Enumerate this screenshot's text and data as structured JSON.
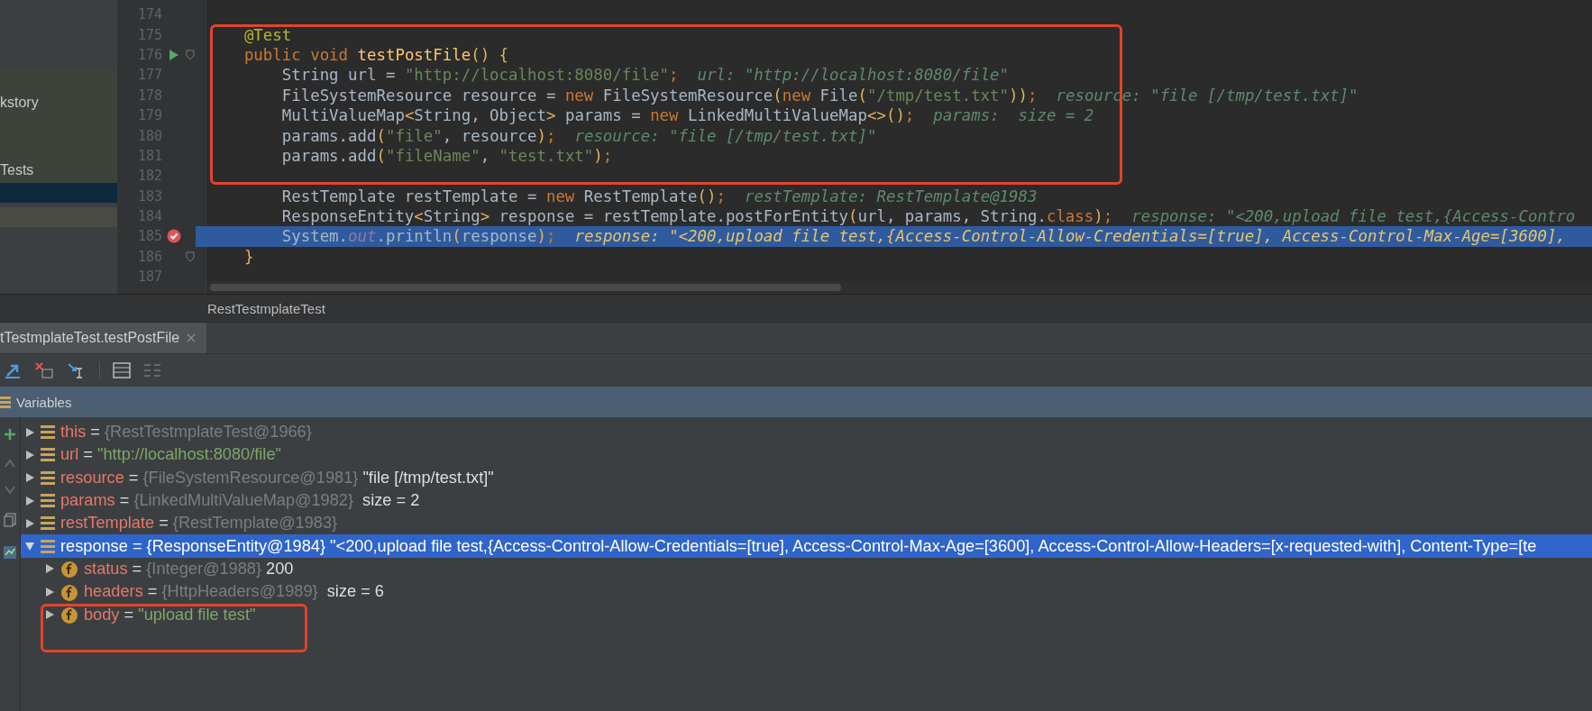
{
  "project_sidebar": {
    "items": [
      {
        "label": "kstory",
        "selected": false
      },
      {
        "label": "Tests",
        "selected": false
      }
    ]
  },
  "editor": {
    "lines": [
      {
        "number": "174",
        "runnable": false,
        "breakpoint": false,
        "foldable": false,
        "selected": false
      },
      {
        "number": "175",
        "runnable": false,
        "breakpoint": false,
        "foldable": false,
        "selected": false,
        "tokens": [
          {
            "t": "    @Test",
            "kind": "ann"
          }
        ]
      },
      {
        "number": "176",
        "runnable": true,
        "breakpoint": false,
        "foldable": true,
        "selected": false,
        "tokens": [
          {
            "t": "    public void ",
            "kind": "kw"
          },
          {
            "t": "testPostFile",
            "kind": "meth"
          },
          {
            "t": "() {",
            "kind": "punct"
          }
        ]
      },
      {
        "number": "177",
        "runnable": false,
        "breakpoint": false,
        "foldable": false,
        "selected": false,
        "tokens": [
          {
            "t": "        String url = ",
            "kind": "plain"
          },
          {
            "t": "\"http://localhost:8080/file\"",
            "kind": "str"
          },
          {
            "t": ";",
            "kind": "kw"
          }
        ],
        "hint": "url: \"http://localhost:8080/file\""
      },
      {
        "number": "178",
        "runnable": false,
        "breakpoint": false,
        "foldable": false,
        "selected": false,
        "tokens": [
          {
            "t": "        FileSystemResource resource = ",
            "kind": "plain"
          },
          {
            "t": "new",
            "kind": "kw"
          },
          {
            "t": " FileSystemResource",
            "kind": "plain"
          },
          {
            "t": "(",
            "kind": "punct"
          },
          {
            "t": "new",
            "kind": "kw"
          },
          {
            "t": " File",
            "kind": "plain"
          },
          {
            "t": "(",
            "kind": "punct"
          },
          {
            "t": "\"/tmp/test.txt\"",
            "kind": "str"
          },
          {
            "t": "))",
            "kind": "punct"
          },
          {
            "t": ";",
            "kind": "kw"
          }
        ],
        "hint": "resource: \"file [/tmp/test.txt]\""
      },
      {
        "number": "179",
        "runnable": false,
        "breakpoint": false,
        "foldable": false,
        "selected": false,
        "tokens": [
          {
            "t": "        MultiValueMap",
            "kind": "plain"
          },
          {
            "t": "<",
            "kind": "punct"
          },
          {
            "t": "String, Object",
            "kind": "plain"
          },
          {
            "t": ">",
            "kind": "punct"
          },
          {
            "t": " params = ",
            "kind": "plain"
          },
          {
            "t": "new",
            "kind": "kw"
          },
          {
            "t": " LinkedMultiValueMap",
            "kind": "plain"
          },
          {
            "t": "<>()",
            "kind": "punct"
          },
          {
            "t": ";",
            "kind": "kw"
          }
        ],
        "hint": "params:  size = 2"
      },
      {
        "number": "180",
        "runnable": false,
        "breakpoint": false,
        "foldable": false,
        "selected": false,
        "tokens": [
          {
            "t": "        params.add",
            "kind": "plain"
          },
          {
            "t": "(",
            "kind": "punct"
          },
          {
            "t": "\"file\"",
            "kind": "str"
          },
          {
            "t": ", resource",
            "kind": "plain"
          },
          {
            "t": ")",
            "kind": "punct"
          },
          {
            "t": ";",
            "kind": "kw"
          }
        ],
        "hint": "resource: \"file [/tmp/test.txt]\""
      },
      {
        "number": "181",
        "runnable": false,
        "breakpoint": false,
        "foldable": false,
        "selected": false,
        "tokens": [
          {
            "t": "        params.add",
            "kind": "plain"
          },
          {
            "t": "(",
            "kind": "punct"
          },
          {
            "t": "\"fileName\"",
            "kind": "str"
          },
          {
            "t": ", ",
            "kind": "plain"
          },
          {
            "t": "\"test.txt\"",
            "kind": "str"
          },
          {
            "t": ")",
            "kind": "punct"
          },
          {
            "t": ";",
            "kind": "kw"
          }
        ]
      },
      {
        "number": "182",
        "runnable": false,
        "breakpoint": false,
        "foldable": false,
        "selected": false
      },
      {
        "number": "183",
        "runnable": false,
        "breakpoint": false,
        "foldable": false,
        "selected": false,
        "tokens": [
          {
            "t": "        RestTemplate restTemplate = ",
            "kind": "plain"
          },
          {
            "t": "new",
            "kind": "kw"
          },
          {
            "t": " RestTemplate",
            "kind": "plain"
          },
          {
            "t": "()",
            "kind": "punct"
          },
          {
            "t": ";",
            "kind": "kw"
          }
        ],
        "hint": "restTemplate: RestTemplate@1983"
      },
      {
        "number": "184",
        "runnable": false,
        "breakpoint": false,
        "foldable": false,
        "selected": false,
        "tokens": [
          {
            "t": "        ResponseEntity",
            "kind": "plain"
          },
          {
            "t": "<",
            "kind": "punct"
          },
          {
            "t": "String",
            "kind": "plain"
          },
          {
            "t": ">",
            "kind": "punct"
          },
          {
            "t": " response = restTemplate.postForEntity",
            "kind": "plain"
          },
          {
            "t": "(",
            "kind": "punct"
          },
          {
            "t": "url, params, String.",
            "kind": "plain"
          },
          {
            "t": "class",
            "kind": "kw"
          },
          {
            "t": ")",
            "kind": "punct"
          },
          {
            "t": ";",
            "kind": "kw"
          }
        ],
        "hint": "response: \"<200,upload file test,{Access-Contro"
      },
      {
        "number": "185",
        "runnable": false,
        "breakpoint": true,
        "foldable": false,
        "selected": true,
        "tokens": [
          {
            "t": "        System.",
            "kind": "plain"
          },
          {
            "t": "out",
            "kind": "field"
          },
          {
            "t": ".println",
            "kind": "plain"
          },
          {
            "t": "(",
            "kind": "punct"
          },
          {
            "t": "response",
            "kind": "plain"
          },
          {
            "t": ")",
            "kind": "punct"
          },
          {
            "t": ";",
            "kind": "kw"
          }
        ],
        "hint": "response: \"<200,upload file test,{Access-Control-Allow-Credentials=[true], Access-Control-Max-Age=[3600],"
      },
      {
        "number": "186",
        "runnable": false,
        "breakpoint": false,
        "foldable": true,
        "selected": false,
        "tokens": [
          {
            "t": "    }",
            "kind": "punct"
          }
        ]
      },
      {
        "number": "187",
        "runnable": false,
        "breakpoint": false,
        "foldable": false,
        "selected": false
      }
    ],
    "breadcrumb": "RestTestmplateTest"
  },
  "debug": {
    "tab": {
      "label": "tTestmplateTest.testPostFile",
      "selected": true
    },
    "variables_title": "Variables",
    "variables": [
      {
        "kind": "local",
        "expanded": false,
        "selected": false,
        "tokens": [
          {
            "t": "this",
            "kind": "name"
          },
          {
            "t": " = ",
            "kind": "plain"
          },
          {
            "t": "{RestTestmplateTest@1966}",
            "kind": "ref"
          }
        ]
      },
      {
        "kind": "local",
        "expanded": false,
        "selected": false,
        "tokens": [
          {
            "t": "url",
            "kind": "name"
          },
          {
            "t": " = ",
            "kind": "plain"
          },
          {
            "t": "\"http://localhost:8080/file\"",
            "kind": "str"
          }
        ]
      },
      {
        "kind": "local",
        "expanded": false,
        "selected": false,
        "tokens": [
          {
            "t": "resource",
            "kind": "name"
          },
          {
            "t": " = ",
            "kind": "plain"
          },
          {
            "t": "{FileSystemResource@1981}",
            "kind": "ref"
          },
          {
            "t": " \"file [/tmp/test.txt]\"",
            "kind": "plain"
          }
        ]
      },
      {
        "kind": "local",
        "expanded": false,
        "selected": false,
        "tokens": [
          {
            "t": "params",
            "kind": "name"
          },
          {
            "t": " = ",
            "kind": "plain"
          },
          {
            "t": "{LinkedMultiValueMap@1982}",
            "kind": "ref"
          },
          {
            "t": "  size = 2",
            "kind": "plain"
          }
        ]
      },
      {
        "kind": "local",
        "expanded": false,
        "selected": false,
        "tokens": [
          {
            "t": "restTemplate",
            "kind": "name"
          },
          {
            "t": " = ",
            "kind": "plain"
          },
          {
            "t": "{RestTemplate@1983}",
            "kind": "ref"
          }
        ]
      },
      {
        "kind": "local",
        "expanded": true,
        "selected": true,
        "tokens": [
          {
            "t": "response",
            "kind": "name"
          },
          {
            "t": " = ",
            "kind": "plain"
          },
          {
            "t": "{ResponseEntity@1984}",
            "kind": "ref"
          },
          {
            "t": " \"<200,upload file test,{Access-Control-Allow-Credentials=[true], Access-Control-Max-Age=[3600], Access-Control-Allow-Headers=[x-requested-with], Content-Type=[te",
            "kind": "plain"
          }
        ],
        "children": [
          {
            "kind": "field",
            "expanded": false,
            "selected": false,
            "tokens": [
              {
                "t": "status",
                "kind": "name"
              },
              {
                "t": " = ",
                "kind": "plain"
              },
              {
                "t": "{Integer@1988}",
                "kind": "ref"
              },
              {
                "t": " 200",
                "kind": "plain"
              }
            ]
          },
          {
            "kind": "field",
            "expanded": false,
            "selected": false,
            "tokens": [
              {
                "t": "headers",
                "kind": "name"
              },
              {
                "t": " = ",
                "kind": "plain"
              },
              {
                "t": "{HttpHeaders@1989}",
                "kind": "ref"
              },
              {
                "t": "  size = 6",
                "kind": "plain"
              }
            ]
          },
          {
            "kind": "field",
            "expanded": false,
            "selected": false,
            "tokens": [
              {
                "t": "body",
                "kind": "name"
              },
              {
                "t": " = ",
                "kind": "plain"
              },
              {
                "t": "\"upload file test\"",
                "kind": "str"
              }
            ]
          }
        ]
      }
    ]
  }
}
